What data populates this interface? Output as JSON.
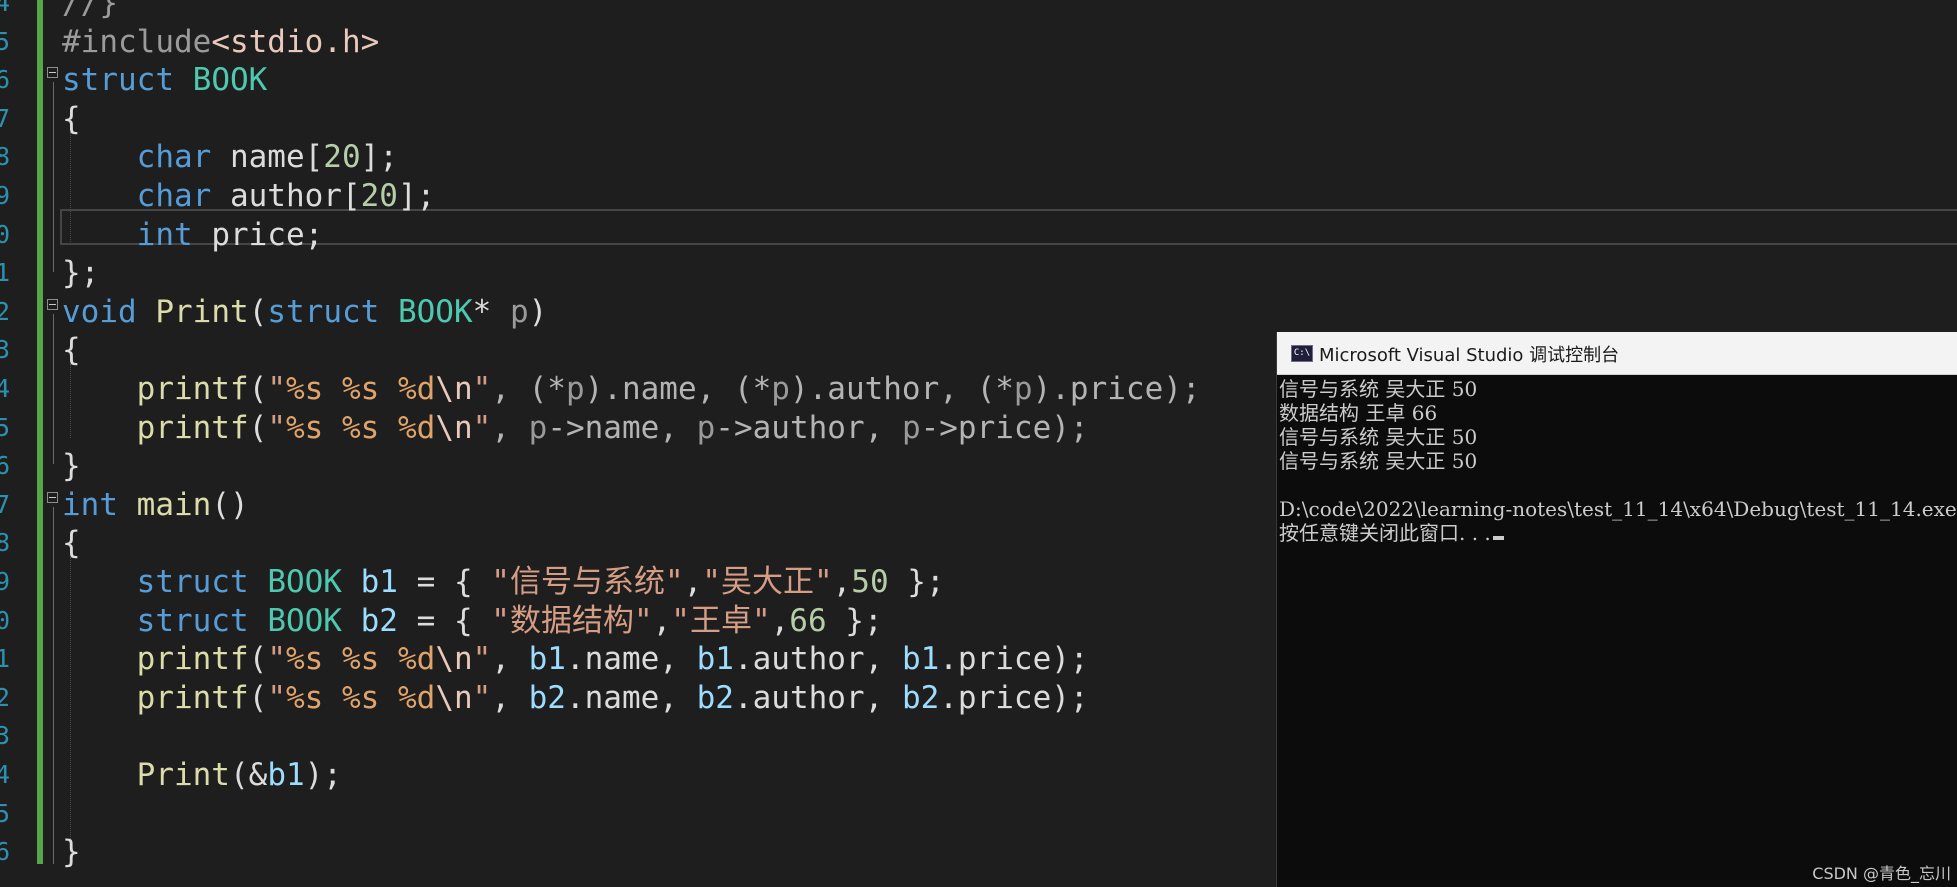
{
  "editor": {
    "line_numbers": [
      "4",
      "5",
      "6",
      "7",
      "8",
      "9",
      "0",
      "1",
      "2",
      "3",
      "4",
      "5",
      "6",
      "7",
      "8",
      "9",
      "0",
      "1",
      "2",
      "3",
      "4",
      "5",
      "6"
    ],
    "lines": [
      [
        {
          "t": "//}",
          "c": "pp"
        }
      ],
      [
        {
          "t": "#include",
          "c": "pp"
        },
        {
          "t": "<stdio.h>",
          "c": "inc"
        }
      ],
      [
        {
          "t": "struct",
          "c": "kw"
        },
        {
          "t": " ",
          "c": "pl"
        },
        {
          "t": "BOOK",
          "c": "ty"
        }
      ],
      [
        {
          "t": "{",
          "c": "pl"
        }
      ],
      [
        {
          "t": "    ",
          "c": "pl"
        },
        {
          "t": "char",
          "c": "kw"
        },
        {
          "t": " name[",
          "c": "pl"
        },
        {
          "t": "20",
          "c": "num"
        },
        {
          "t": "];",
          "c": "pl"
        }
      ],
      [
        {
          "t": "    ",
          "c": "pl"
        },
        {
          "t": "char",
          "c": "kw"
        },
        {
          "t": " author[",
          "c": "pl"
        },
        {
          "t": "20",
          "c": "num"
        },
        {
          "t": "];",
          "c": "pl"
        }
      ],
      [
        {
          "t": "    ",
          "c": "pl"
        },
        {
          "t": "int",
          "c": "kw"
        },
        {
          "t": " price;",
          "c": "pl"
        }
      ],
      [
        {
          "t": "};",
          "c": "pl"
        }
      ],
      [
        {
          "t": "void",
          "c": "kw"
        },
        {
          "t": " ",
          "c": "pl"
        },
        {
          "t": "Print",
          "c": "fn"
        },
        {
          "t": "(",
          "c": "pl"
        },
        {
          "t": "struct",
          "c": "kw"
        },
        {
          "t": " ",
          "c": "pl"
        },
        {
          "t": "BOOK",
          "c": "ty"
        },
        {
          "t": "* ",
          "c": "pl"
        },
        {
          "t": "p",
          "c": "prm"
        },
        {
          "t": ")",
          "c": "pl"
        }
      ],
      [
        {
          "t": "{",
          "c": "pl"
        }
      ],
      [
        {
          "t": "    ",
          "c": "pl"
        },
        {
          "t": "printf",
          "c": "fn"
        },
        {
          "t": "(",
          "c": "pl"
        },
        {
          "t": "\"",
          "c": "st"
        },
        {
          "t": "%s",
          "c": "fmt"
        },
        {
          "t": " ",
          "c": "st"
        },
        {
          "t": "%s",
          "c": "fmt"
        },
        {
          "t": " ",
          "c": "st"
        },
        {
          "t": "%d",
          "c": "fmt"
        },
        {
          "t": "\\n",
          "c": "esc"
        },
        {
          "t": "\"",
          "c": "st"
        },
        {
          "t": ", (*",
          "c": "op"
        },
        {
          "t": "p",
          "c": "prm"
        },
        {
          "t": ").name, (*",
          "c": "op"
        },
        {
          "t": "p",
          "c": "prm"
        },
        {
          "t": ").author, (*",
          "c": "op"
        },
        {
          "t": "p",
          "c": "prm"
        },
        {
          "t": ").price);",
          "c": "op"
        }
      ],
      [
        {
          "t": "    ",
          "c": "pl"
        },
        {
          "t": "printf",
          "c": "fn"
        },
        {
          "t": "(",
          "c": "pl"
        },
        {
          "t": "\"",
          "c": "st"
        },
        {
          "t": "%s",
          "c": "fmt"
        },
        {
          "t": " ",
          "c": "st"
        },
        {
          "t": "%s",
          "c": "fmt"
        },
        {
          "t": " ",
          "c": "st"
        },
        {
          "t": "%d",
          "c": "fmt"
        },
        {
          "t": "\\n",
          "c": "esc"
        },
        {
          "t": "\"",
          "c": "st"
        },
        {
          "t": ", ",
          "c": "op"
        },
        {
          "t": "p",
          "c": "prm"
        },
        {
          "t": "->name, ",
          "c": "op"
        },
        {
          "t": "p",
          "c": "prm"
        },
        {
          "t": "->author, ",
          "c": "op"
        },
        {
          "t": "p",
          "c": "prm"
        },
        {
          "t": "->price);",
          "c": "op"
        }
      ],
      [
        {
          "t": "}",
          "c": "pl"
        }
      ],
      [
        {
          "t": "int",
          "c": "kw"
        },
        {
          "t": " ",
          "c": "pl"
        },
        {
          "t": "main",
          "c": "fn"
        },
        {
          "t": "()",
          "c": "pl"
        }
      ],
      [
        {
          "t": "{",
          "c": "pl"
        }
      ],
      [
        {
          "t": "    ",
          "c": "pl"
        },
        {
          "t": "struct",
          "c": "kw"
        },
        {
          "t": " ",
          "c": "pl"
        },
        {
          "t": "BOOK",
          "c": "ty"
        },
        {
          "t": " ",
          "c": "pl"
        },
        {
          "t": "b1",
          "c": "var"
        },
        {
          "t": " = { ",
          "c": "pl"
        },
        {
          "t": "\"信号与系统\"",
          "c": "st"
        },
        {
          "t": ",",
          "c": "pl"
        },
        {
          "t": "\"吴大正\"",
          "c": "st"
        },
        {
          "t": ",",
          "c": "pl"
        },
        {
          "t": "50",
          "c": "num"
        },
        {
          "t": " };",
          "c": "pl"
        }
      ],
      [
        {
          "t": "    ",
          "c": "pl"
        },
        {
          "t": "struct",
          "c": "kw"
        },
        {
          "t": " ",
          "c": "pl"
        },
        {
          "t": "BOOK",
          "c": "ty"
        },
        {
          "t": " ",
          "c": "pl"
        },
        {
          "t": "b2",
          "c": "var"
        },
        {
          "t": " = { ",
          "c": "pl"
        },
        {
          "t": "\"数据结构\"",
          "c": "st"
        },
        {
          "t": ",",
          "c": "pl"
        },
        {
          "t": "\"王卓\"",
          "c": "st"
        },
        {
          "t": ",",
          "c": "pl"
        },
        {
          "t": "66",
          "c": "num"
        },
        {
          "t": " };",
          "c": "pl"
        }
      ],
      [
        {
          "t": "    ",
          "c": "pl"
        },
        {
          "t": "printf",
          "c": "fn"
        },
        {
          "t": "(",
          "c": "pl"
        },
        {
          "t": "\"",
          "c": "st"
        },
        {
          "t": "%s",
          "c": "fmt"
        },
        {
          "t": " ",
          "c": "st"
        },
        {
          "t": "%s",
          "c": "fmt"
        },
        {
          "t": " ",
          "c": "st"
        },
        {
          "t": "%d",
          "c": "fmt"
        },
        {
          "t": "\\n",
          "c": "esc"
        },
        {
          "t": "\"",
          "c": "st"
        },
        {
          "t": ", ",
          "c": "pl"
        },
        {
          "t": "b1",
          "c": "var"
        },
        {
          "t": ".name, ",
          "c": "pl"
        },
        {
          "t": "b1",
          "c": "var"
        },
        {
          "t": ".author, ",
          "c": "pl"
        },
        {
          "t": "b1",
          "c": "var"
        },
        {
          "t": ".price);",
          "c": "pl"
        }
      ],
      [
        {
          "t": "    ",
          "c": "pl"
        },
        {
          "t": "printf",
          "c": "fn"
        },
        {
          "t": "(",
          "c": "pl"
        },
        {
          "t": "\"",
          "c": "st"
        },
        {
          "t": "%s",
          "c": "fmt"
        },
        {
          "t": " ",
          "c": "st"
        },
        {
          "t": "%s",
          "c": "fmt"
        },
        {
          "t": " ",
          "c": "st"
        },
        {
          "t": "%d",
          "c": "fmt"
        },
        {
          "t": "\\n",
          "c": "esc"
        },
        {
          "t": "\"",
          "c": "st"
        },
        {
          "t": ", ",
          "c": "pl"
        },
        {
          "t": "b2",
          "c": "var"
        },
        {
          "t": ".name, ",
          "c": "pl"
        },
        {
          "t": "b2",
          "c": "var"
        },
        {
          "t": ".author, ",
          "c": "pl"
        },
        {
          "t": "b2",
          "c": "var"
        },
        {
          "t": ".price);",
          "c": "pl"
        }
      ],
      [
        {
          "t": "",
          "c": "pl"
        }
      ],
      [
        {
          "t": "    ",
          "c": "pl"
        },
        {
          "t": "Print",
          "c": "fn"
        },
        {
          "t": "(&",
          "c": "pl"
        },
        {
          "t": "b1",
          "c": "var"
        },
        {
          "t": ");",
          "c": "pl"
        }
      ],
      [
        {
          "t": "",
          "c": "pl"
        }
      ],
      [
        {
          "t": "}",
          "c": "pl"
        }
      ]
    ]
  },
  "console": {
    "icon_label": "C:\\",
    "title": "Microsoft Visual Studio 调试控制台",
    "output_lines": [
      "信号与系统 吴大正 50",
      "数据结构 王卓 66",
      "信号与系统 吴大正 50",
      "信号与系统 吴大正 50",
      "",
      "D:\\code\\2022\\learning-notes\\test_11_14\\x64\\Debug\\test_11_14.exe",
      "按任意键关闭此窗口. . ."
    ]
  },
  "watermark": "CSDN @青色_忘川",
  "colors": {
    "editor_bg": "#1e1e1e",
    "keyword": "#569cd6",
    "type": "#4ec9b0",
    "function": "#dcdcaa",
    "string": "#d69d85",
    "number": "#b5cea8",
    "variable": "#9cdcfe",
    "line_number": "#2b91af",
    "change_bar": "#57a64a",
    "console_bg": "#0c0c0c"
  }
}
